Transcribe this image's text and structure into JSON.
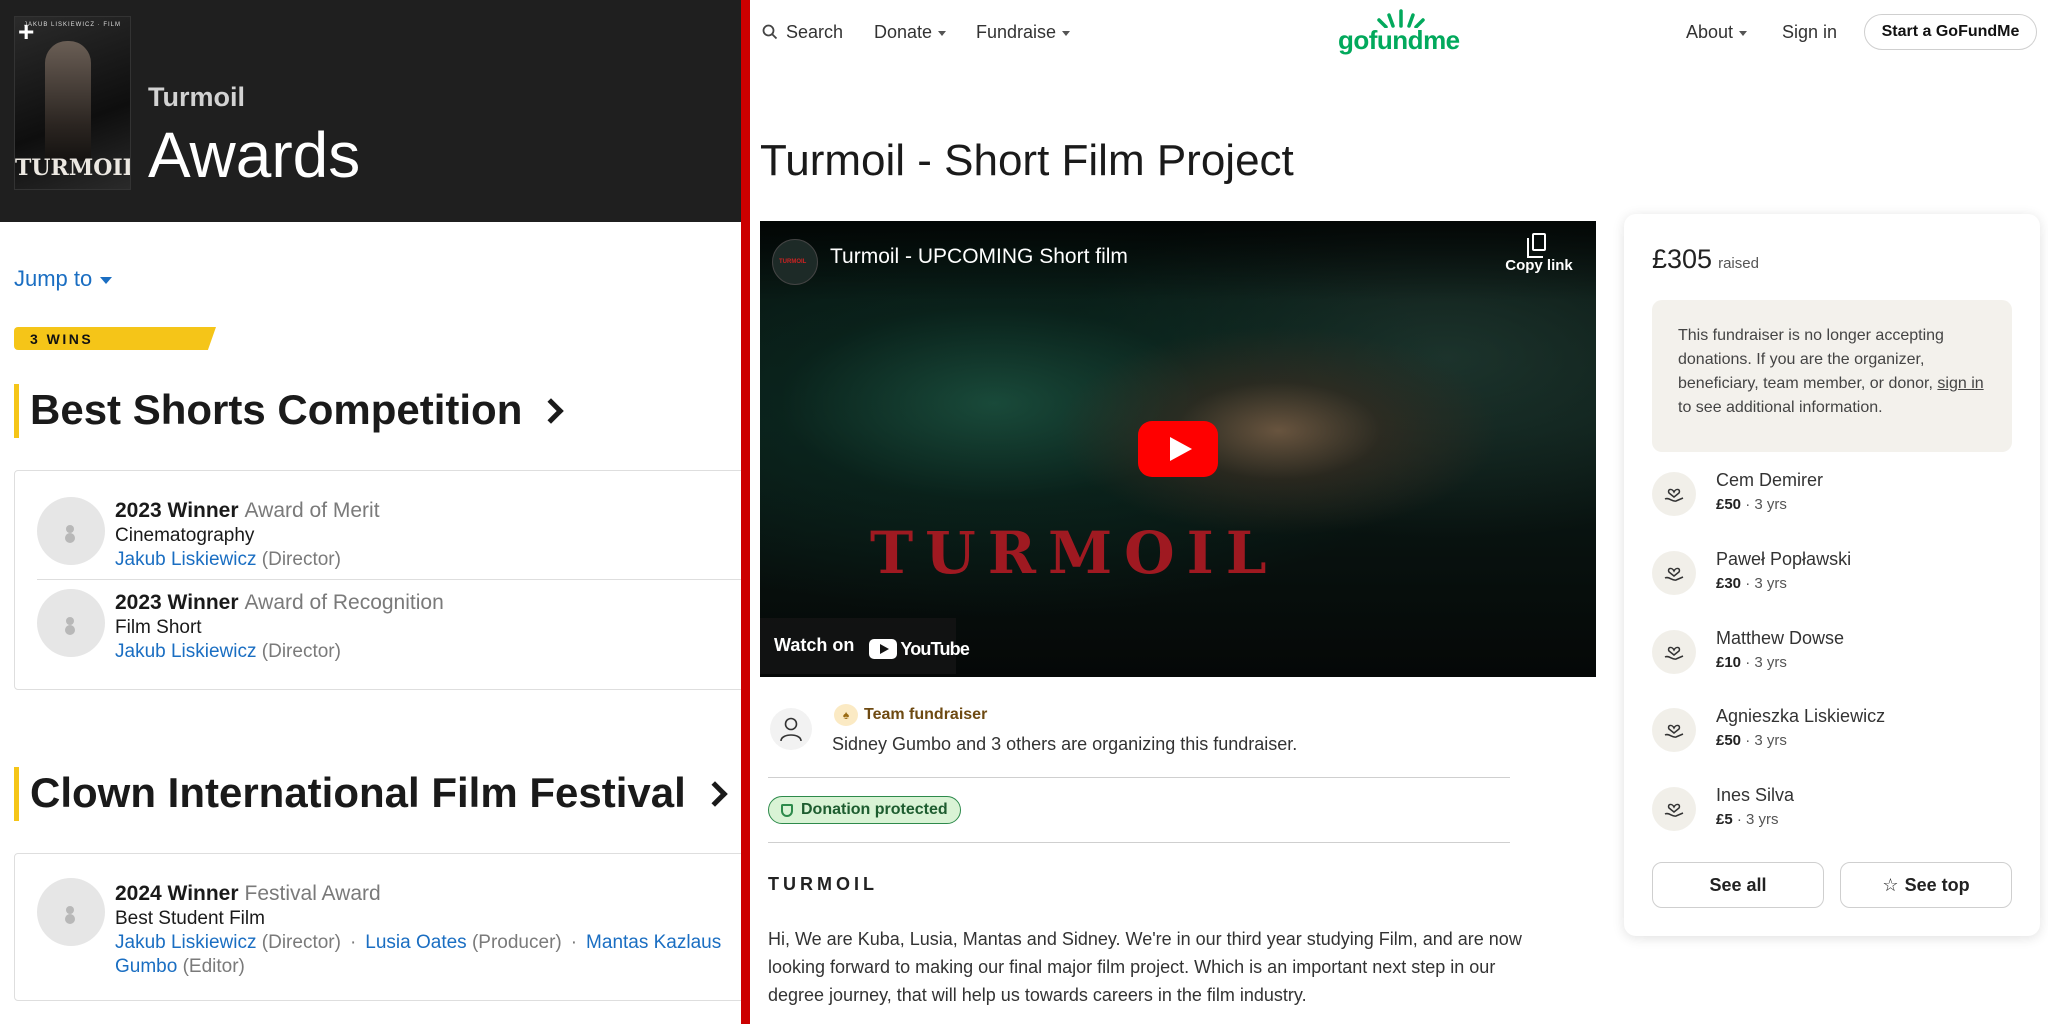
{
  "imdb": {
    "film_title": "Turmoil",
    "page_heading": "Awards",
    "poster": {
      "tagline": "JAKUB LISKIEWICZ · FILM",
      "caption": "TURMOIL",
      "add_label": "+"
    },
    "jump_to": "Jump to",
    "wins_badge": "3 WINS",
    "sections": [
      {
        "title": "Best Shorts Competition",
        "awards": [
          {
            "outcome": "2023 Winner",
            "category": "Award of Merit",
            "detail": "Cinematography",
            "people": [
              {
                "name": "Jakub Liskiewicz",
                "role": "(Director)"
              }
            ]
          },
          {
            "outcome": "2023 Winner",
            "category": "Award of Recognition",
            "detail": "Film Short",
            "people": [
              {
                "name": "Jakub Liskiewicz",
                "role": "(Director)"
              }
            ]
          }
        ]
      },
      {
        "title": "Clown International Film Festival",
        "awards": [
          {
            "outcome": "2024 Winner",
            "category": "Festival Award",
            "detail": "Best Student Film",
            "people": [
              {
                "name": "Jakub Liskiewicz",
                "role": "(Director)"
              },
              {
                "name": "Lusia Oates",
                "role": "(Producer)"
              },
              {
                "name": "Mantas Kazlaus",
                "role": ""
              }
            ],
            "people_line2": [
              {
                "name": "Gumbo",
                "role": "(Editor)"
              }
            ],
            "separator": "·"
          }
        ]
      }
    ]
  },
  "gofundme": {
    "nav": {
      "search": "Search",
      "donate": "Donate",
      "fundraise": "Fundraise",
      "about": "About",
      "sign_in": "Sign in",
      "start": "Start a GoFundMe"
    },
    "logo": "gofundme",
    "campaign_title": "Turmoil - Short Film Project",
    "video": {
      "title": "Turmoil - UPCOMING Short film",
      "copy_link": "Copy link",
      "wordmark": "TURMOIL",
      "watch_on": "Watch on",
      "yt_text": "YouTube"
    },
    "organizer": {
      "team_label": "Team fundraiser",
      "text": "Sidney Gumbo and 3 others are organizing this fundraiser."
    },
    "protected": "Donation protected",
    "story": {
      "heading": "TURMOIL",
      "body": "Hi, We are Kuba, Lusia, Mantas and Sidney. We're in our third year studying Film, and are now looking forward to making our final major film project. Which is an important next step in our degree journey, that will help us towards careers in the film industry."
    },
    "sidebar": {
      "raised_amount": "£305",
      "raised_label": "raised",
      "notice_pre": "This fundraiser is no longer accepting donations. If you are the organizer, beneficiary, team member, or donor, ",
      "notice_link": "sign in",
      "notice_post": " to see additional information.",
      "donors": [
        {
          "name": "Cem Demirer",
          "amount": "£50",
          "time": " · 3 yrs"
        },
        {
          "name": "Paweł Popławski",
          "amount": "£30",
          "time": " · 3 yrs"
        },
        {
          "name": "Matthew Dowse",
          "amount": "£10",
          "time": " · 3 yrs"
        },
        {
          "name": "Agnieszka Liskiewicz",
          "amount": "£50",
          "time": " · 3 yrs"
        },
        {
          "name": "Ines Silva",
          "amount": "£5",
          "time": " · 3 yrs"
        }
      ],
      "see_all": "See all",
      "see_top": "See top"
    },
    "colors": {
      "brand_green": "#02a95c",
      "imdb_yellow": "#f5c518",
      "divider_red": "#cc0000",
      "link_blue": "#1a6ec2"
    }
  }
}
